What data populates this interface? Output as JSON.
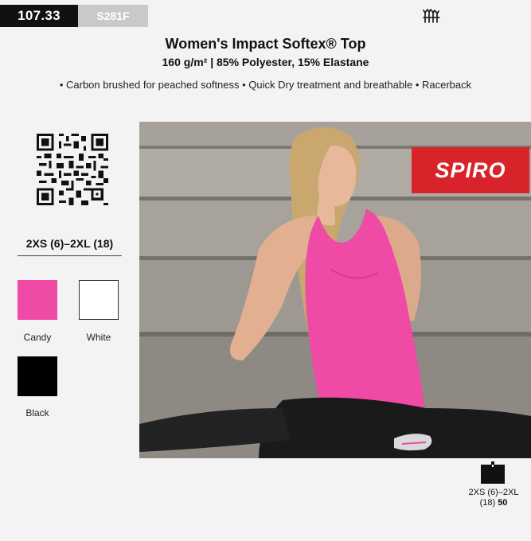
{
  "header": {
    "page_number": "107.33",
    "style_code": "S281F"
  },
  "product": {
    "title": "Women's Impact Softex® Top",
    "subtitle": "160 g/m² | 85% Polyester, 15% Elastane",
    "features": "• Carbon brushed for peached softness • Quick Dry treatment and breathable • Racerback"
  },
  "sizes": {
    "range": "2XS (6)–2XL (18)"
  },
  "colors": [
    {
      "name": "Candy",
      "hex": "#ee4aa6"
    },
    {
      "name": "White",
      "hex": "#ffffff"
    },
    {
      "name": "Black",
      "hex": "#000000"
    }
  ],
  "brand": {
    "logo_text": "SPIRO",
    "logo_color": "#d8232a"
  },
  "packaging": {
    "size_line1": "2XS (6)–2XL",
    "size_line2": "(18)",
    "quantity": "50"
  },
  "icons": {
    "grade": "fitness-grade-icon",
    "pack": "carton-box-icon",
    "qr": "qr-code-icon"
  }
}
